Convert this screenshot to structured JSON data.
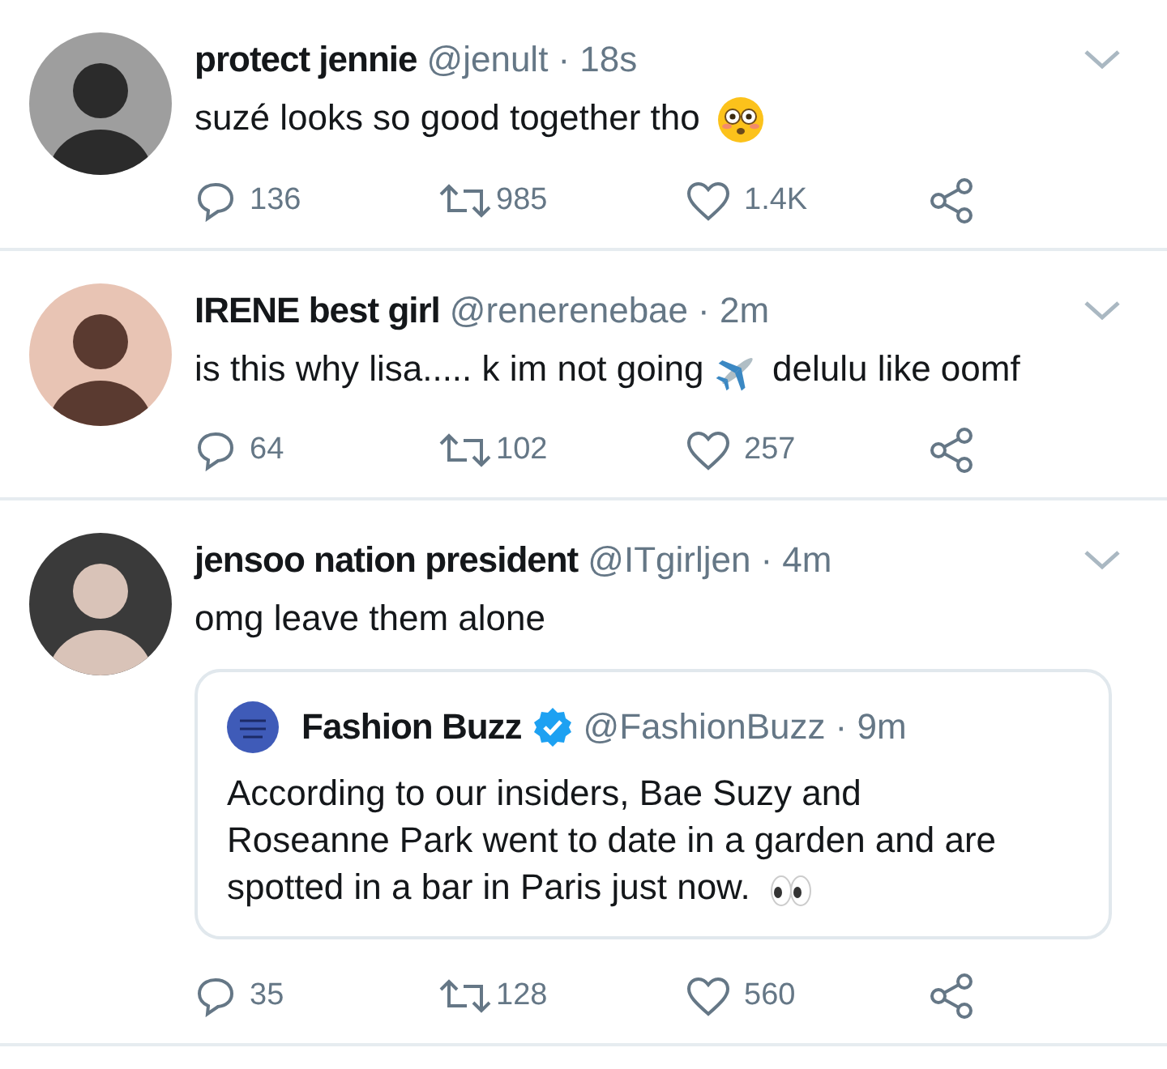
{
  "tweets": [
    {
      "name": "protect jennie",
      "handle": "@jenult",
      "time": "· 18s",
      "body": [
        {
          "kind": "text",
          "text": "suzé looks so good together tho"
        },
        {
          "kind": "flushed-emoji"
        }
      ],
      "replies": "136",
      "retweets": "985",
      "likes": "1.4K"
    },
    {
      "name": "IRENE best girl",
      "handle": "@renerenebae",
      "time": "· 2m",
      "body": [
        {
          "kind": "text",
          "text": "is this why lisa..... k im not going"
        },
        {
          "kind": "plane-emoji"
        },
        {
          "kind": "text",
          "text": "delulu like oomf"
        }
      ],
      "replies": "64",
      "retweets": "102",
      "likes": "257"
    },
    {
      "name": "jensoo nation president",
      "handle": "@ITgirljen",
      "time": "· 4m",
      "body": [
        {
          "kind": "text",
          "text": "omg leave them alone"
        }
      ],
      "quote": {
        "name": "Fashion Buzz",
        "verified": true,
        "handle": "@FashionBuzz",
        "time": "· 9m",
        "body": [
          {
            "kind": "text",
            "text": "According to our insiders, Bae Suzy and Roseanne Park went to date in a garden and are spotted in a bar in Paris just now."
          },
          {
            "kind": "eyes-emoji"
          }
        ]
      },
      "replies": "35",
      "retweets": "128",
      "likes": "560"
    }
  ]
}
